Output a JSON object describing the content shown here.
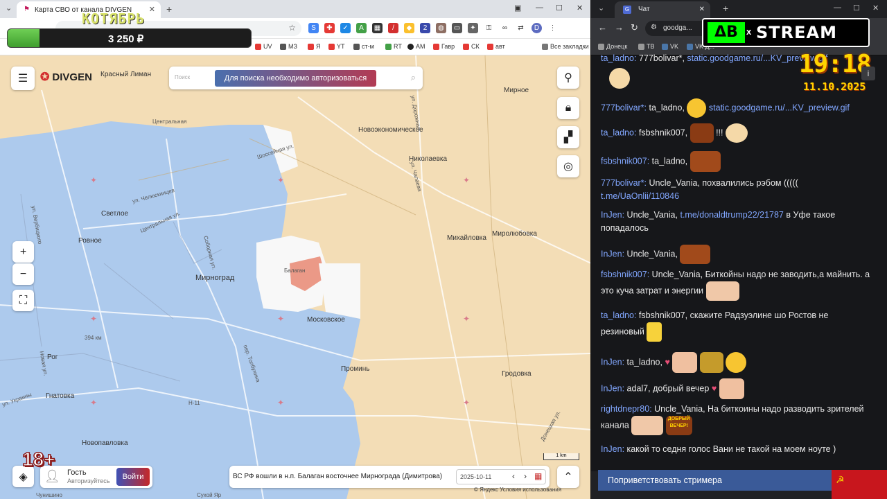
{
  "left_browser": {
    "tab_title": "Карта СВО от канала DIVGEN",
    "bookmarks": [
      "UV",
      "МЗ",
      "Я",
      "YT",
      "ст-м",
      "RT",
      "AM",
      "Гавр",
      "СК",
      "авт",
      "Все закладки"
    ]
  },
  "overlay": {
    "month_label": "КОТЯБРЬ",
    "money": "3 250 ₽",
    "money_progress": 0.13,
    "age": "18+"
  },
  "map": {
    "logo": "DIVGEN",
    "search_placeholder": "Поиск",
    "auth_notice": "Для поиска необходимо авторизоваться",
    "labels": {
      "krasny_liman": "Красный Лиман",
      "mirnoe": "Мирное",
      "novoekonomicheskoe": "Новоэкономическое",
      "nikolaevka": "Николаевка",
      "svetloe": "Светлое",
      "rovnoe": "Ровное",
      "mirnograd": "Мирноград",
      "balagan": "Балаган",
      "mikhaylovka": "Михайловка",
      "mirolyubovka": "Миролюбовка",
      "moskovskoe": "Московское",
      "rog": "Рог",
      "gnatovka": "Гнатовка",
      "promin": "Проминь",
      "grodovka": "Гродовка",
      "novopavlovka": "Новопавловка",
      "tsentralnaya": "Центральная",
      "road_394": "394 км",
      "n11": "Н-11",
      "shosseyna": "Шоссейная ул.",
      "sobornaya": "Соборная ул.",
      "tsentralnaya_ul": "Центральная ул.",
      "chelyuskintsev": "ул. Челюскинцев",
      "tolbukhina": "пер. Толбухина",
      "sukhoy_yar": "Сухой Яр",
      "chunishino": "Чунишино",
      "ukrainy": "ул. Украины",
      "donetskaya": "Донецкая ул.",
      "doroga": "ул. Дорожная",
      "vyborgskaya": "ул. Вербицкого",
      "novaya": "Новая ул.",
      "tsentr2": "ул. Чапаева"
    },
    "user": {
      "name": "Гость",
      "status": "Авторизуйтесь",
      "login": "Войти"
    },
    "news": "ВС РФ вошли в н.п. Балаган восточнее Мирнограда (Димитрова)",
    "date": "2025-10-11",
    "scale": "1 km",
    "attribution": "© Яндекс Условия использования",
    "zoom_in": "+",
    "zoom_out": "−"
  },
  "right_browser": {
    "tab_title": "Чат",
    "url": "goodga...",
    "bookmarks": [
      "Донецк",
      "ТВ",
      "VK",
      "VK Д..."
    ]
  },
  "stream": {
    "brand_ab": "ΔB",
    "brand_x": "x",
    "brand_stream": "STREAM",
    "clock": "19:18",
    "date": "11.10.2025"
  },
  "chat": [
    {
      "nick": "ta_ladno:",
      "text": "777bolivar*,",
      "link": "static.goodgame.ru/...KV_preview.gif"
    },
    {
      "nick": "777bolivar*:",
      "text": "ta_ladno,",
      "link": "static.goodgame.ru/...KV_preview.gif"
    },
    {
      "nick": "ta_ladno:",
      "text": "fsbshnik007,",
      "extra": "!!!"
    },
    {
      "nick": "fsbshnik007:",
      "text": "ta_ladno,"
    },
    {
      "nick": "777bolivar*:",
      "text": "Uncle_Vania, похвалились рэбом (((((",
      "link": "t.me/UaOnlii/110846"
    },
    {
      "nick": "InJen:",
      "text": "Uncle_Vania,",
      "link": "t.me/donaldtrump22/21787",
      "extra": "в Уфе такое попадалось"
    },
    {
      "nick": "InJen:",
      "text": "Uncle_Vania,"
    },
    {
      "nick": "fsbshnik007:",
      "text": "Uncle_Vania, Биткойны надо не заводить,а майнить. а это куча затрат и энергии"
    },
    {
      "nick": "ta_ladno:",
      "text": "fsbshnik007, скажите Радзуэлине шо Ростов не резиновый"
    },
    {
      "nick": "InJen:",
      "text": "ta_ladno,"
    },
    {
      "nick": "InJen:",
      "text": "adal7, добрый вечер"
    },
    {
      "nick": "rightdnepr80:",
      "text": "Uncle_Vania, На биткоины надо разводить зрителей канала",
      "extra": "ДОБРЫЙ ВЕЧЕР!"
    },
    {
      "nick": "InJen:",
      "text": "какой то седня голос Вани не такой на моем ноуте )"
    }
  ],
  "chat_greet": "Поприветствовать стримера",
  "colors": {
    "occupied": "#f3ddb6",
    "controlled": "#a9c8f0",
    "grey": "#f8f8f8",
    "new": "#e98e7a"
  }
}
